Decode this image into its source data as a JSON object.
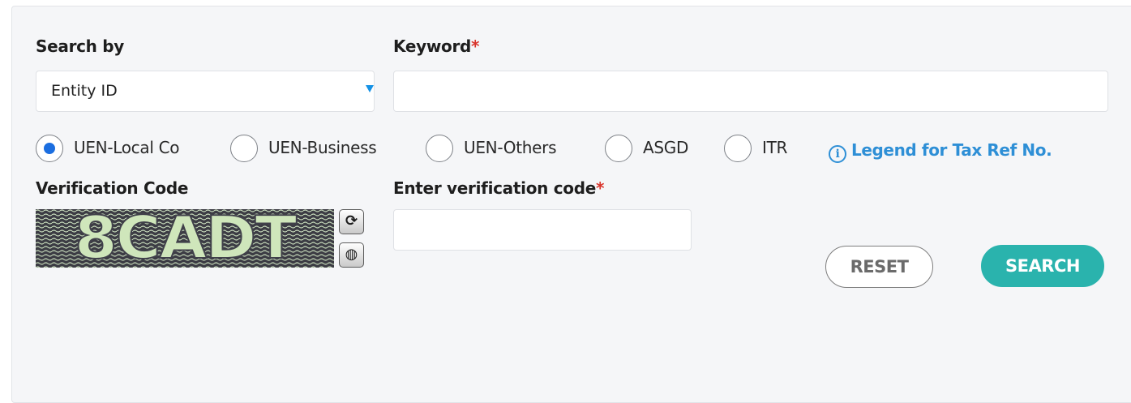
{
  "search_by": {
    "label": "Search by",
    "selected": "Entity ID"
  },
  "keyword": {
    "label": "Keyword",
    "required_mark": "*",
    "value": "",
    "placeholder": ""
  },
  "id_type": {
    "options": [
      {
        "label": "UEN-Local Co",
        "checked": true
      },
      {
        "label": "UEN-Business",
        "checked": false
      },
      {
        "label": "UEN-Others",
        "checked": false
      },
      {
        "label": "ASGD",
        "checked": false
      },
      {
        "label": "ITR",
        "checked": false
      }
    ],
    "legend_link": "Legend for Tax Ref No."
  },
  "verification": {
    "label": "Verification Code",
    "captcha_text": "8CADT",
    "enter_label": "Enter verification code",
    "required_mark": "*",
    "value": ""
  },
  "actions": {
    "reset_label": "RESET",
    "search_label": "SEARCH"
  },
  "colors": {
    "accent": "#2ab3ad",
    "link": "#2e8fd6",
    "required": "#d9342b",
    "radio_checked": "#1b6ee0"
  }
}
